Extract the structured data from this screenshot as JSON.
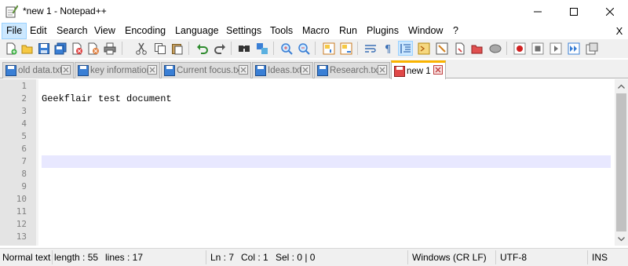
{
  "window": {
    "title": "*new 1 - Notepad++",
    "minimize_glyph": "—",
    "maximize_glyph": "☐",
    "close_glyph": "✕"
  },
  "menu": {
    "items": [
      "File",
      "Edit",
      "Search",
      "View",
      "Encoding",
      "Language",
      "Settings",
      "Tools",
      "Macro",
      "Run",
      "Plugins",
      "Window",
      "?"
    ],
    "close_label": "X"
  },
  "toolbar": {
    "icons": [
      "new-file-icon",
      "open-file-icon",
      "save-icon",
      "save-all-icon",
      "close-icon",
      "close-all-icon",
      "print-icon",
      "cut-icon",
      "copy-icon",
      "paste-icon",
      "undo-icon",
      "redo-icon",
      "find-icon",
      "replace-icon",
      "zoom-in-icon",
      "zoom-out-icon",
      "sync-vertical-icon",
      "sync-horizontal-icon",
      "word-wrap-icon",
      "show-all-chars-icon",
      "indent-guide-icon",
      "doc-map-icon",
      "function-list-icon",
      "folder-workspace-icon",
      "doc-list-icon",
      "monitoring-icon",
      "record-macro-icon",
      "stop-record-icon",
      "play-macro-icon",
      "run-macro-multiple-icon",
      "save-macro-icon"
    ]
  },
  "tabs": [
    {
      "label": "old data.txt",
      "active": false,
      "unsaved": false
    },
    {
      "label": "key information",
      "active": false,
      "unsaved": false
    },
    {
      "label": "Current focus.txt",
      "active": false,
      "unsaved": false
    },
    {
      "label": "Ideas.txt",
      "active": false,
      "unsaved": false
    },
    {
      "label": "Research.txt",
      "active": false,
      "unsaved": false
    },
    {
      "label": "new 1",
      "active": true,
      "unsaved": true
    }
  ],
  "editor": {
    "line_numbers": [
      "1",
      "2",
      "3",
      "4",
      "5",
      "6",
      "7",
      "8",
      "9",
      "10",
      "11",
      "12",
      "13"
    ],
    "lines": [
      "",
      "Geekflair test document",
      "",
      "",
      "",
      "",
      "",
      "",
      "",
      "",
      "",
      "",
      ""
    ],
    "current_line": 7
  },
  "status": {
    "language": "Normal text",
    "length": "length : 55",
    "lines": "lines : 17",
    "ln": "Ln : 7",
    "col": "Col : 1",
    "sel": "Sel : 0 | 0",
    "eol": "Windows (CR LF)",
    "encoding": "UTF-8",
    "mode": "INS"
  },
  "colors": {
    "active_tab_accent": "#fab400",
    "current_line_bg": "#e8e8ff",
    "gutter_bg": "#e4e4e4",
    "menu_highlight": "#cce8ff"
  }
}
